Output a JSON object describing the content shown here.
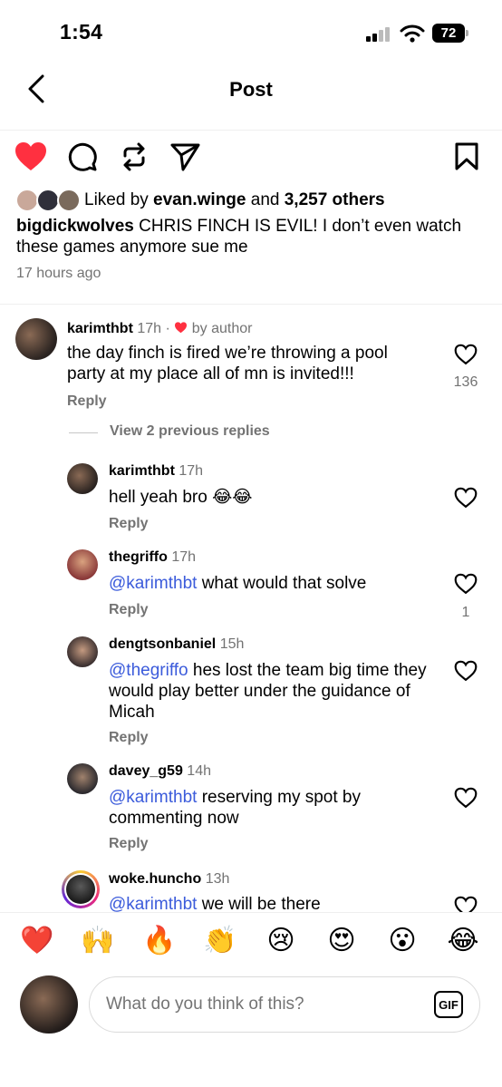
{
  "status_bar": {
    "time": "1:54",
    "battery": "72"
  },
  "header": {
    "title": "Post"
  },
  "post": {
    "liked_by_prefix": "Liked by ",
    "liked_by_user": "evan.winge",
    "liked_by_middle": " and ",
    "liked_by_count": "3,257 others",
    "caption_user": "bigdickwolves",
    "caption_text": " CHRIS FINCH IS EVIL! I don’t even watch these games anymore sue me",
    "timestamp": "17 hours ago"
  },
  "comment": {
    "username": "karimthbt",
    "time": "17h",
    "by_author": "by author",
    "text": "the day finch is fired we’re throwing a pool party at my place all of mn is invited!!!",
    "reply_label": "Reply",
    "likes": "136"
  },
  "view_replies": "View 2 previous replies",
  "replies": [
    {
      "username": "karimthbt",
      "time": "17h",
      "mention": "",
      "text": "hell yeah bro 😂😂",
      "reply_label": "Reply",
      "likes": ""
    },
    {
      "username": "thegriffo",
      "time": "17h",
      "mention": "@karimthbt",
      "text": " what would that solve",
      "reply_label": "Reply",
      "likes": "1"
    },
    {
      "username": "dengtsonbaniel",
      "time": "15h",
      "mention": "@thegriffo",
      "text": " hes lost the team big time they would play better under the guidance of Micah",
      "reply_label": "Reply",
      "likes": ""
    },
    {
      "username": "davey_g59",
      "time": "14h",
      "mention": "@karimthbt",
      "text": " reserving my spot by commenting now",
      "reply_label": "Reply",
      "likes": ""
    },
    {
      "username": "woke.huncho",
      "time": "13h",
      "mention": "@karimthbt",
      "text": " we will be there",
      "reply_label": "",
      "likes": ""
    }
  ],
  "emoji_bar": [
    "❤️",
    "🙌",
    "🔥",
    "👏",
    "😢",
    "😍",
    "😮",
    "😂"
  ],
  "comment_input": {
    "placeholder": "What do you think of this?",
    "gif_label": "GIF"
  },
  "colors": {
    "like_red": "#ff3040",
    "mention_blue": "#3b5bdb",
    "secondary_text": "#737373"
  }
}
